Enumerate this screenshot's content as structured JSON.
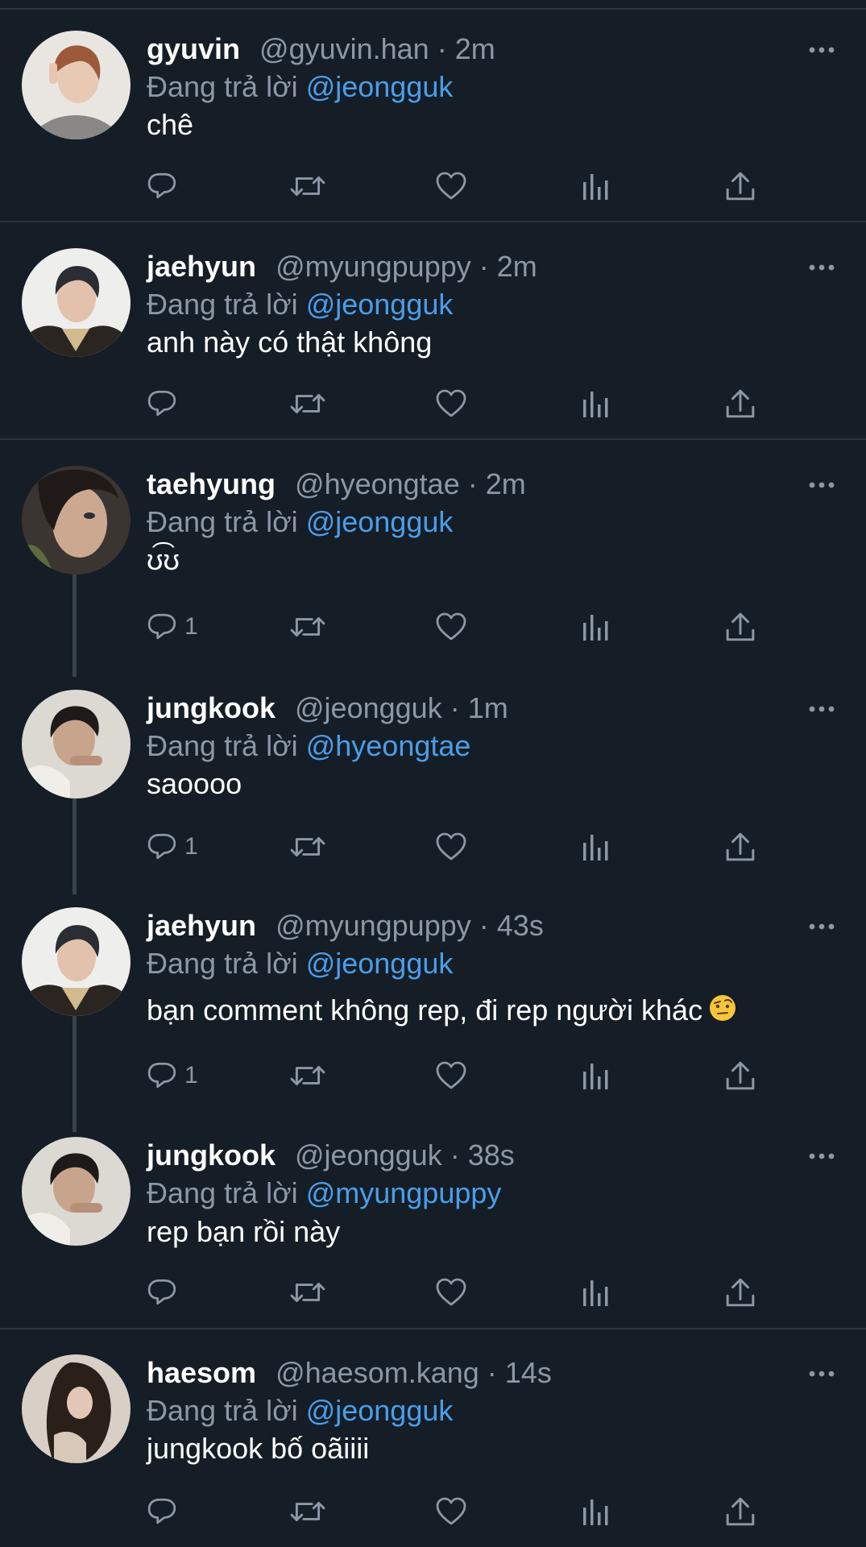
{
  "reply_prefix": "Đang trả lời",
  "colors": {
    "background": "#151d26",
    "divider": "#2b3540",
    "secondary_text": "#8b98a5",
    "mention": "#4a9eea",
    "thread_line": "#38444d"
  },
  "icons": {
    "reply": "reply-bubble-icon",
    "retweet": "retweet-icon",
    "like": "heart-icon",
    "views": "views-bar-chart-icon",
    "share": "share-upload-icon",
    "more": "more-dots-icon"
  },
  "tweets": [
    {
      "name": "gyuvin",
      "handle": "@gyuvin.han",
      "separator": "·",
      "time": "2m",
      "replying_to": "@jeongguk",
      "text": "chê",
      "reply_count": ""
    },
    {
      "name": "jaehyun",
      "handle": "@myungpuppy",
      "separator": "·",
      "time": "2m",
      "replying_to": "@jeongguk",
      "text": "anh này có thật không",
      "reply_count": ""
    },
    {
      "name": "taehyung",
      "handle": "@hyeongtae",
      "separator": "·",
      "time": "2m",
      "replying_to": "@jeongguk",
      "text": "ʊ͡ʊ",
      "reply_count": "1"
    },
    {
      "name": "jungkook",
      "handle": "@jeongguk",
      "separator": "·",
      "time": "1m",
      "replying_to": "@hyeongtae",
      "text": "saoooo",
      "reply_count": "1"
    },
    {
      "name": "jaehyun",
      "handle": "@myungpuppy",
      "separator": "·",
      "time": "43s",
      "replying_to": "@jeongguk",
      "text": "bạn comment không rep, đi rep người khác",
      "emoji": "face-with-raised-eyebrow",
      "reply_count": "1"
    },
    {
      "name": "jungkook",
      "handle": "@jeongguk",
      "separator": "·",
      "time": "38s",
      "replying_to": "@myungpuppy",
      "text": "rep bạn rồi này",
      "reply_count": ""
    },
    {
      "name": "haesom",
      "handle": "@haesom.kang",
      "separator": "·",
      "time": "14s",
      "replying_to": "@jeongguk",
      "text": "jungkook bố oãiiii",
      "reply_count": ""
    }
  ]
}
